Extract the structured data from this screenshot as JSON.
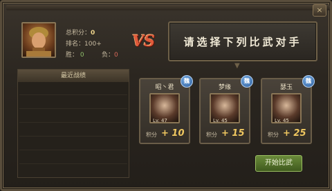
{
  "window": {
    "close_label": "×"
  },
  "player": {
    "total_points_label": "总积分：",
    "total_points": "0",
    "rank_label": "排名：",
    "rank": "100+",
    "wins_label": "胜：",
    "wins": "0",
    "losses_label": "负：",
    "losses": "0"
  },
  "vs_label": "VS",
  "prompt": "请选择下列比武对手",
  "records": {
    "title": "最近战绩"
  },
  "opponents": [
    {
      "name": "昭丶君",
      "level": "Lv. 47",
      "score_label": "积分",
      "score": "+ 10",
      "faction": "魏"
    },
    {
      "name": "梦缘",
      "level": "Lv. 45",
      "score_label": "积分",
      "score": "+ 15",
      "faction": "魏"
    },
    {
      "name": "瑟玉",
      "level": "Lv. 45",
      "score_label": "积分",
      "score": "+ 25",
      "faction": "魏"
    }
  ],
  "start_button": "开始比武",
  "colors": {
    "accent_gold": "#f0c860",
    "vs_red": "#e05a3a",
    "button_green": "#6a8a3a",
    "faction_blue": "#2a5a98"
  },
  "icons": {
    "close": "close-icon",
    "faction": "faction-badge-icon"
  }
}
